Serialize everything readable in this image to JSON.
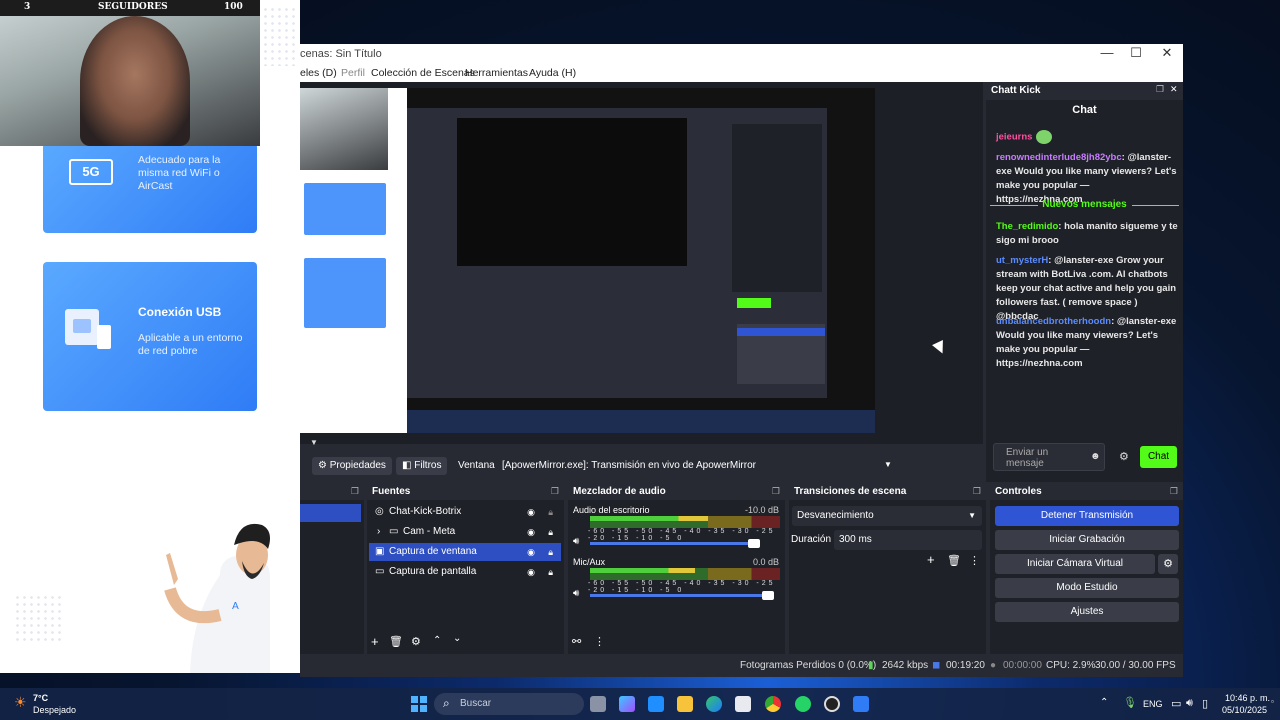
{
  "overlay": {
    "followers_count": "3",
    "followers_label": "SEGUIDORES",
    "followers_goal": "100",
    "cards": [
      {
        "icon": "5G",
        "title": "",
        "text": "Adecuado para la misma red WiFi o AirCast"
      },
      {
        "icon": "usb",
        "title": "Conexión USB",
        "text": "Aplicable a un entorno de red pobre"
      }
    ]
  },
  "obs": {
    "window_title": "cenas: Sin Título",
    "menu": [
      "eles (D)",
      "Perfil",
      "Colección de Escenas",
      "Herramientas",
      "Ayuda (H)"
    ],
    "window_controls": {
      "minimize": "—",
      "maximize": "☐",
      "close": "✕"
    },
    "properties_bar": {
      "properties": "Propiedades",
      "filters": "Filtros",
      "window_label": "Ventana",
      "window_value": "[ApowerMirror.exe]: Transmisión en vivo de ApowerMirror"
    },
    "sources": {
      "title": "Fuentes",
      "items": [
        {
          "icon": "globe",
          "label": "Chat-Kick-Botrix",
          "selected": false
        },
        {
          "icon": "folder",
          "label": "Cam - Meta",
          "selected": false
        },
        {
          "icon": "window",
          "label": "Captura de ventana",
          "selected": true
        },
        {
          "icon": "monitor",
          "label": "Captura de pantalla",
          "selected": false
        }
      ]
    },
    "mixer": {
      "title": "Mezclador de audio",
      "channels": [
        {
          "name": "Audio del escritorio",
          "db": "-10.0 dB",
          "level": 0.62,
          "volume": 0.92
        },
        {
          "name": "Mic/Aux",
          "db": "0.0 dB",
          "level": 0.55,
          "volume": 1.0
        }
      ],
      "ticks": "-60 -55 -50 -45 -40 -35 -30 -25 -20 -15 -10 -5 0"
    },
    "transitions": {
      "title": "Transiciones de escena",
      "selected": "Desvanecimiento",
      "duration_label": "Duración",
      "duration_value": "300 ms"
    },
    "controls": {
      "title": "Controles",
      "buttons": [
        "Detener Transmisión",
        "Iniciar Grabación",
        "Iniciar Cámara Virtual",
        "Modo Estudio",
        "Ajustes"
      ]
    },
    "status": {
      "dropped": "Fotogramas Perdidos 0 (0.0%)",
      "bitrate": "2642 kbps",
      "live_time": "00:19:20",
      "rec_time": "00:00:00",
      "cpu": "CPU: 2.9%",
      "fps": "30.00 / 30.00 FPS"
    }
  },
  "kick_chat": {
    "dock_title": "Chatt Kick",
    "title": "Chat",
    "messages": [
      {
        "user": "jeieurns",
        "text": "",
        "color": "#ff4fa0"
      },
      {
        "user": "renownedinterlude8jh82ybc",
        "text": ": @lanster-exe Would you like many viewers? Let's make you popular — https://nezhna.com",
        "color": "#c77dff"
      }
    ],
    "new_messages_label": "Nuevos mensajes",
    "new_msgs": [
      {
        "user": "The_redimido",
        "text": ": hola manito sigueme y te sigo mi brooo",
        "color": "#53fc18"
      },
      {
        "user": "ut_mysterH",
        "text": ": @lanster-exe Grow your stream with BotLiva .com. AI chatbots keep your chat active and help you gain followers fast. ( remove space ) @bbcdac",
        "color": "#5b8cff"
      },
      {
        "user": "unbalancedbrotherhoodn",
        "text": ": @lanster-exe Would you like many viewers? Let's make you popular — https://nezhna.com",
        "color": "#5b8cff"
      }
    ],
    "input_placeholder": "Enviar un mensaje",
    "send_label": "Chat"
  },
  "taskbar": {
    "weather_temp": "7°C",
    "weather_desc": "Despejado",
    "search_placeholder": "Buscar",
    "language": "ENG",
    "time": "10:46 p. m.",
    "date": "05/10/2025"
  },
  "colors": {
    "accent": "#2f55d4",
    "kick_green": "#53fc18",
    "obs_bg": "#272a33"
  }
}
